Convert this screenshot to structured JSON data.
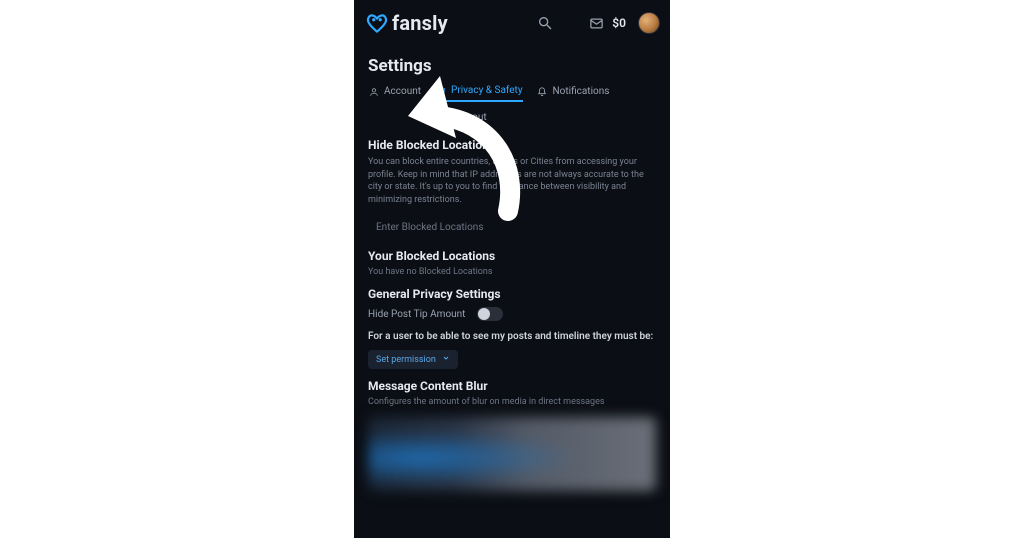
{
  "brand": {
    "name": "fansly"
  },
  "header": {
    "balance": "$0"
  },
  "page": {
    "title": "Settings"
  },
  "tabs": {
    "account": "Account",
    "privacy": "Privacy & Safety",
    "notifications": "Notifications",
    "about": "About"
  },
  "block_locations": {
    "heading": "Hide Blocked Locations",
    "description": "You can block entire countries, States or Cities from accessing your profile. Keep in mind that IP addresses are not always accurate to the city or state. It's up to you to find a balance between visibility and minimizing restrictions.",
    "input_placeholder": "Enter Blocked Locations"
  },
  "your_blocked": {
    "heading": "Your Blocked Locations",
    "empty": "You have no Blocked Locations"
  },
  "general_privacy": {
    "heading": "General Privacy Settings",
    "row1_label": "Hide Post Tip Amount",
    "row2_label": "For a user to be able to see my posts and timeline they must be:",
    "dropdown_label": "Set permission"
  },
  "message_blur": {
    "heading": "Message Content Blur",
    "sub": "Configures the amount of blur on media in direct messages"
  }
}
